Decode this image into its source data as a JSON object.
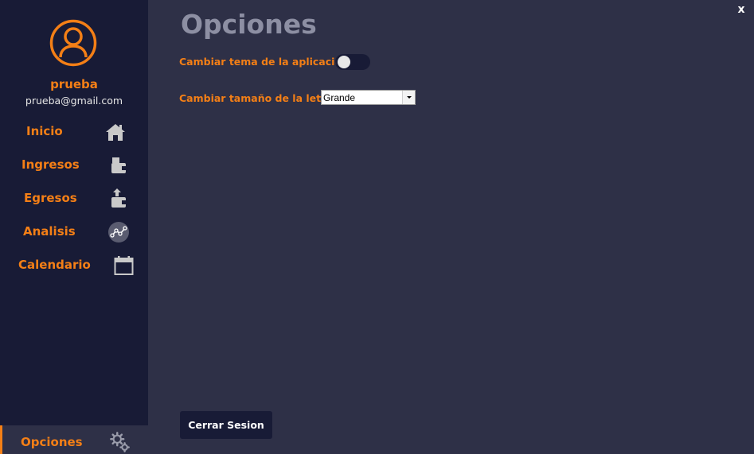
{
  "window": {
    "close_label": "x"
  },
  "sidebar": {
    "user": {
      "name": "prueba",
      "email": "prueba@gmail.com"
    },
    "items": [
      {
        "label": "Inicio",
        "icon": "home-icon"
      },
      {
        "label": "Ingresos",
        "icon": "wallet-in-icon"
      },
      {
        "label": "Egresos",
        "icon": "wallet-out-icon"
      },
      {
        "label": "Analisis",
        "icon": "analytics-icon"
      },
      {
        "label": "Calendario",
        "icon": "calendar-icon"
      },
      {
        "label": "Opciones",
        "icon": "gears-icon",
        "active": true
      }
    ]
  },
  "main": {
    "title": "Opciones",
    "theme_toggle": {
      "label": "Cambiar tema de la aplicacion",
      "on": false
    },
    "font_size": {
      "label": "Cambiar tamaño de la letra",
      "value": "Grande"
    },
    "logout_label": "Cerrar Sesion"
  },
  "colors": {
    "accent": "#f47f16",
    "sidebar_bg": "#181b36",
    "main_bg": "#2e3047",
    "title": "#8d8fa3"
  }
}
